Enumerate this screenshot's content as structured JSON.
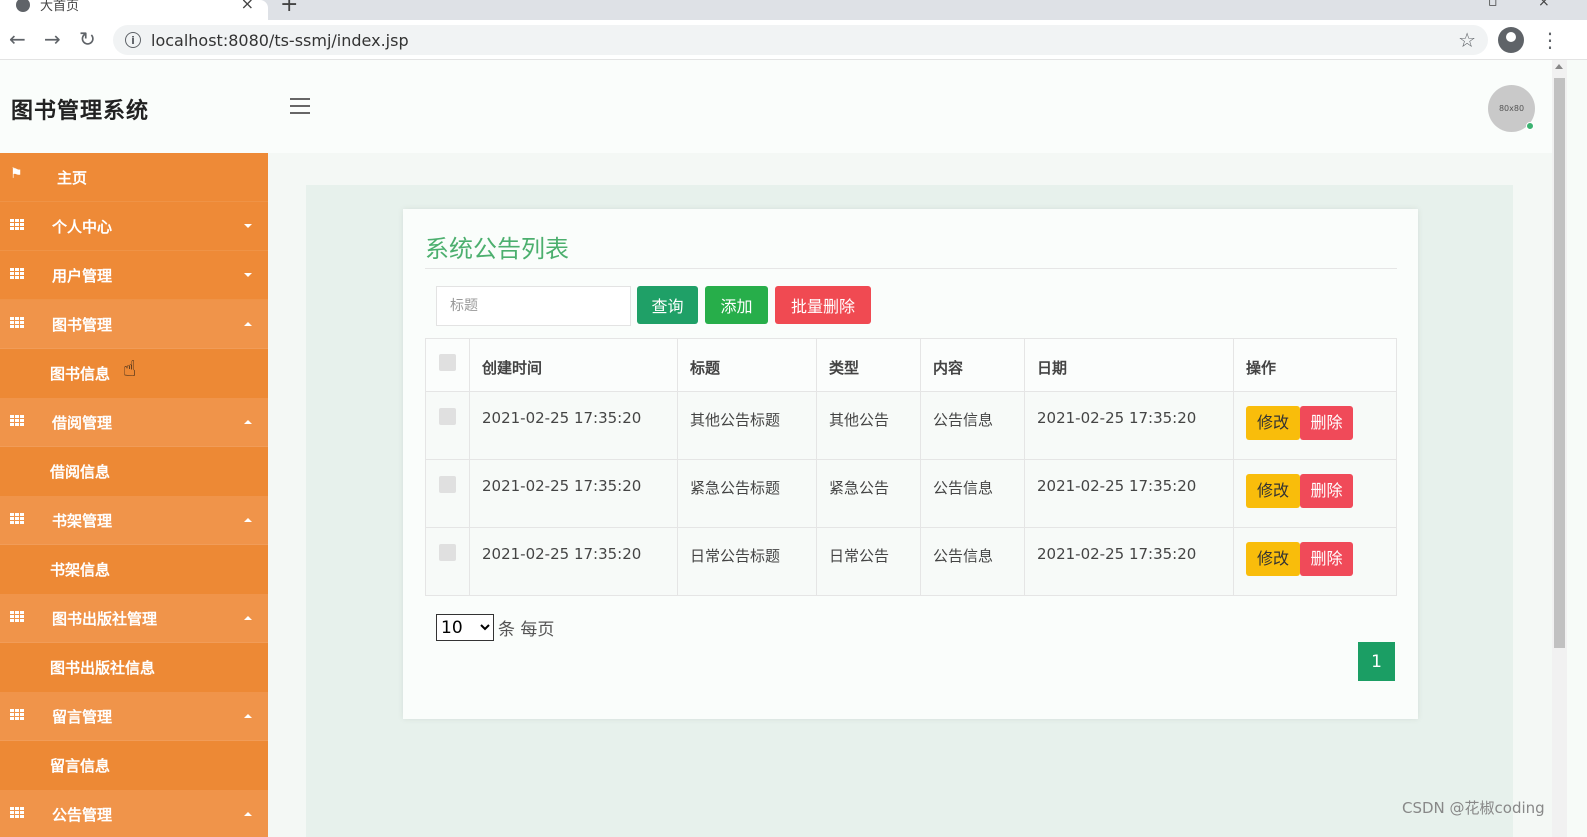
{
  "browser": {
    "tab_title": "大首页",
    "url": "localhost:8080/ts-ssmj/index.jsp"
  },
  "header": {
    "brand": "图书管理系统",
    "avatar_text": "80x80"
  },
  "sidebar": {
    "items": [
      {
        "label": "主页"
      },
      {
        "label": "个人中心"
      },
      {
        "label": "用户管理"
      },
      {
        "label": "图书管理"
      },
      {
        "label": "图书信息"
      },
      {
        "label": "借阅管理"
      },
      {
        "label": "借阅信息"
      },
      {
        "label": "书架管理"
      },
      {
        "label": "书架信息"
      },
      {
        "label": "图书出版社管理"
      },
      {
        "label": "图书出版社信息"
      },
      {
        "label": "留言管理"
      },
      {
        "label": "留言信息"
      },
      {
        "label": "公告管理"
      }
    ]
  },
  "main": {
    "title": "系统公告列表",
    "search_placeholder": "标题",
    "query_label": "查询",
    "add_label": "添加",
    "batch_delete_label": "批量删除",
    "columns": [
      "创建时间",
      "标题",
      "类型",
      "内容",
      "日期",
      "操作"
    ],
    "rows": [
      {
        "created": "2021-02-25 17:35:20",
        "title": "其他公告标题",
        "type": "其他公告",
        "content": "公告信息",
        "date": "2021-02-25 17:35:20"
      },
      {
        "created": "2021-02-25 17:35:20",
        "title": "紧急公告标题",
        "type": "紧急公告",
        "content": "公告信息",
        "date": "2021-02-25 17:35:20"
      },
      {
        "created": "2021-02-25 17:35:20",
        "title": "日常公告标题",
        "type": "日常公告",
        "content": "公告信息",
        "date": "2021-02-25 17:35:20"
      }
    ],
    "edit_label": "修改",
    "delete_label": "删除",
    "page_size_value": "10",
    "page_size_suffix": "条 每页",
    "current_page": "1"
  },
  "watermark": "CSDN @花椒coding",
  "colors": {
    "sidebar": "#ee8a37",
    "title_green": "#4caf6e",
    "query": "#1fa067",
    "add": "#27ae4a",
    "danger": "#f04a52",
    "warning": "#f9bd0b"
  }
}
